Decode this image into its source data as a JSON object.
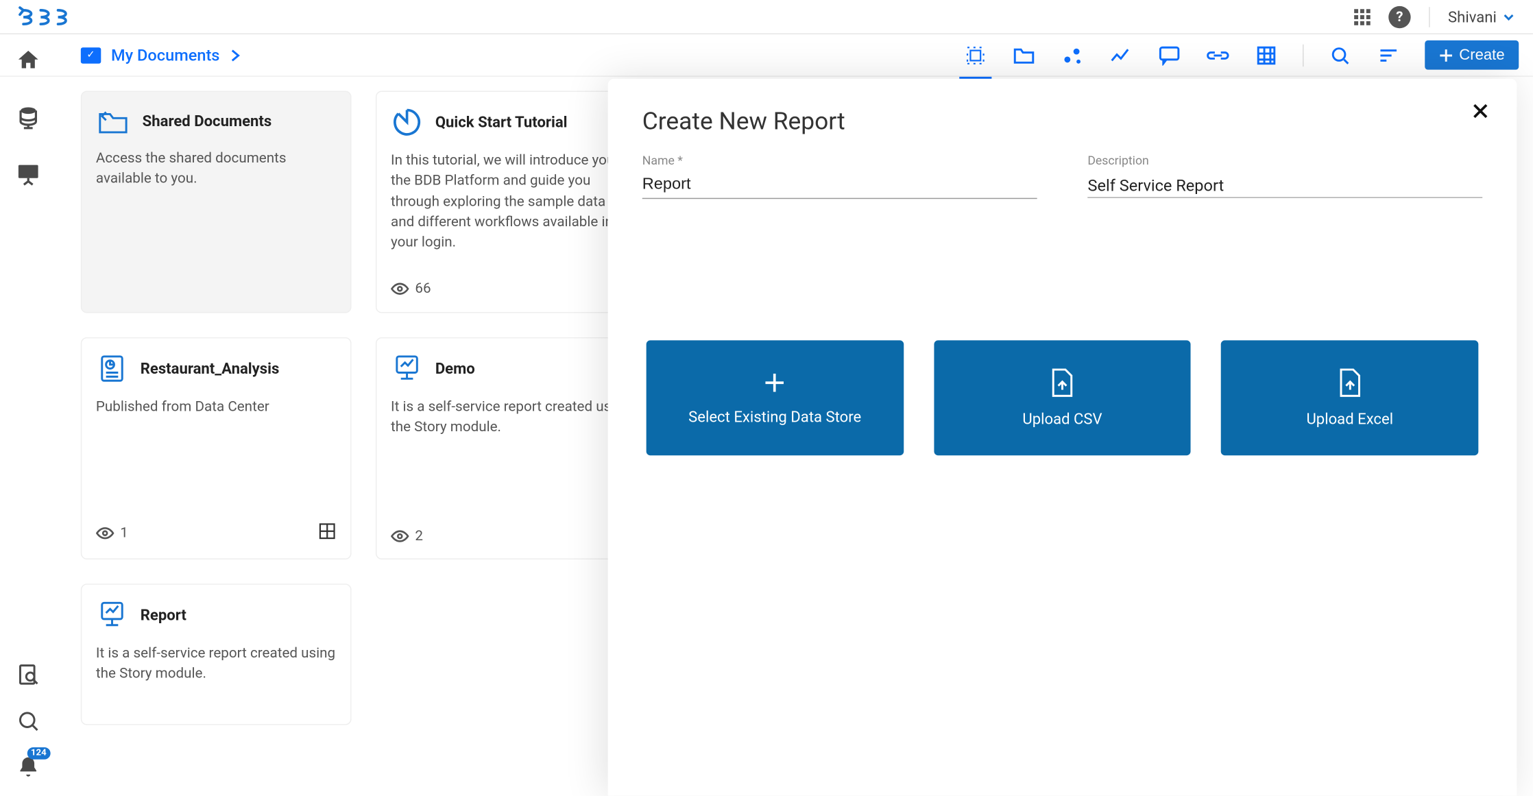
{
  "header": {
    "user_name": "Shivani",
    "notifications": "124"
  },
  "breadcrumb": {
    "label": "My Documents"
  },
  "toolbar": {
    "create_label": "Create"
  },
  "cards": [
    {
      "title": "Shared Documents",
      "desc": "Access the shared documents available to you."
    },
    {
      "title": "Quick Start Tutorial",
      "desc": "In this tutorial, we will introduce you to the BDB Platform and guide you through exploring the sample data and different workflows available in your login.",
      "views": "66"
    },
    {
      "title": "Restaurant_Analysis",
      "desc": "Published from Data Center",
      "views": "1"
    },
    {
      "title": "Demo",
      "desc": "It is a self-service report created using the Story module.",
      "views": "2"
    },
    {
      "title": "Report",
      "desc": "It is a self-service report created using the Story module."
    }
  ],
  "modal": {
    "title": "Create New Report",
    "name_label": "Name *",
    "name_value": "Report",
    "desc_label": "Description",
    "desc_value": "Self Service Report",
    "actions": {
      "existing": "Select Existing Data Store",
      "csv": "Upload CSV",
      "excel": "Upload Excel"
    }
  }
}
